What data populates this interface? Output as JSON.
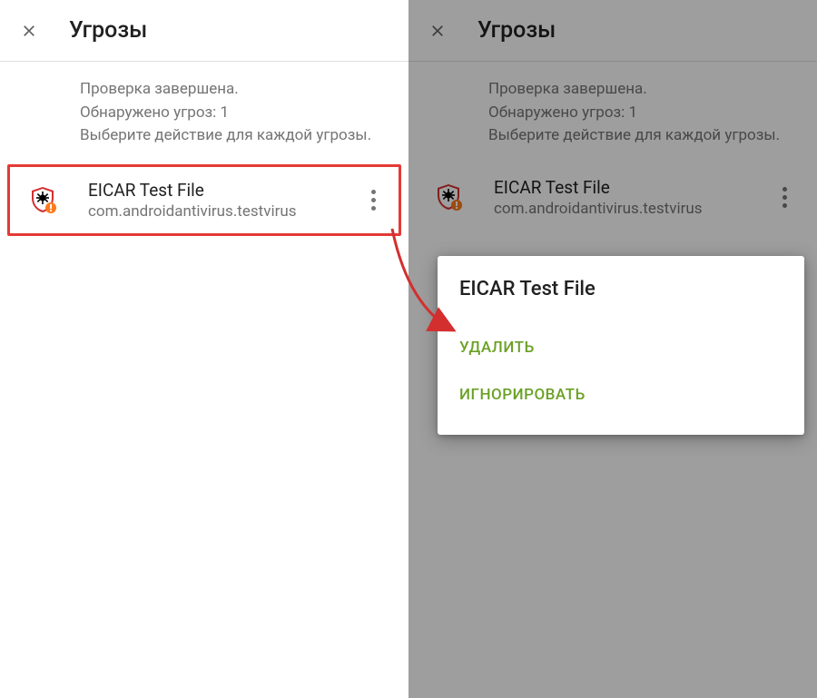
{
  "header": {
    "title": "Угрозы"
  },
  "summary": {
    "line1": "Проверка завершена.",
    "line2": "Обнаружено угроз: 1",
    "line3": "Выберите действие для каждой угрозы."
  },
  "threat": {
    "name": "EICAR Test File",
    "package": "com.androidantivirus.testvirus"
  },
  "popup": {
    "title": "EICAR Test File",
    "delete": "УДАЛИТЬ",
    "ignore": "ИГНОРИРОВАТЬ"
  },
  "icons": {
    "close": "close-icon",
    "shield": "shield-threat-icon",
    "more": "more-vert-icon"
  },
  "colors": {
    "highlight_border": "#e53935",
    "action_green": "#6ba126",
    "arrow_red": "#d32f2f"
  }
}
